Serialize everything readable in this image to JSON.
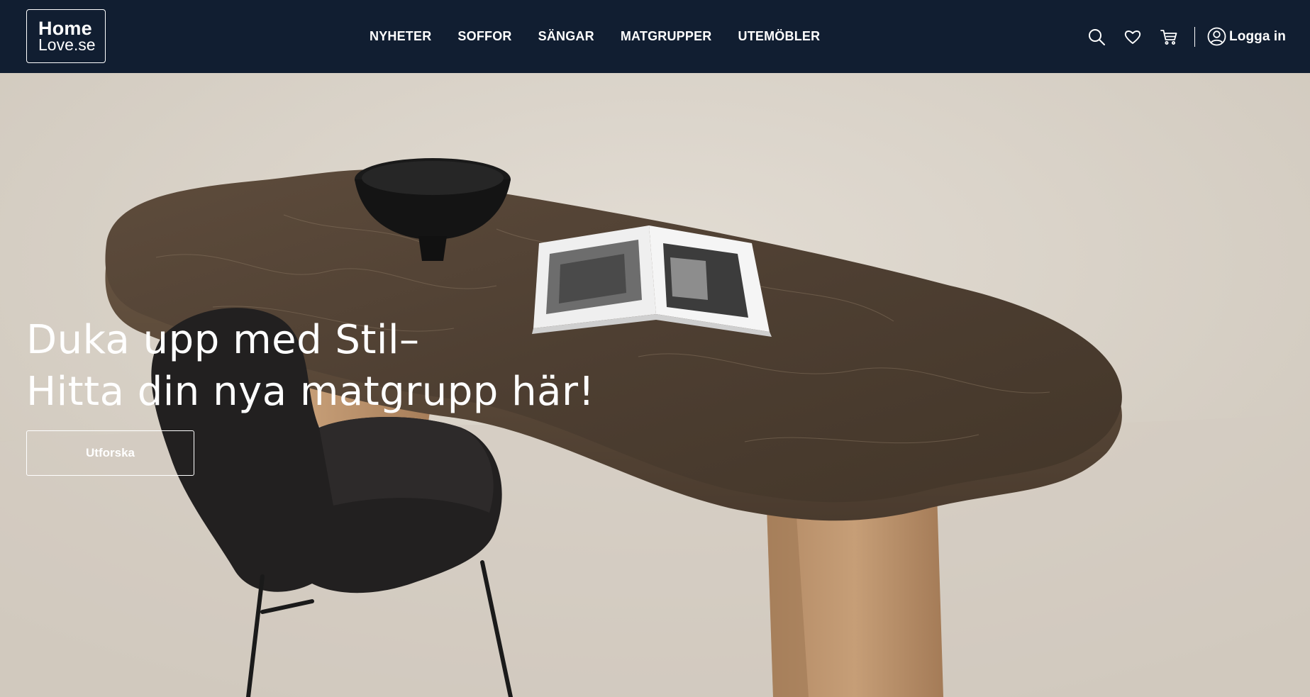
{
  "brand": {
    "line1": "Home",
    "line2": "Love.se"
  },
  "nav": {
    "items": [
      {
        "label": "NYHETER"
      },
      {
        "label": "SOFFOR"
      },
      {
        "label": "SÄNGAR"
      },
      {
        "label": "MATGRUPPER"
      },
      {
        "label": "UTEMÖBLER"
      }
    ]
  },
  "header_actions": {
    "icons": [
      "search-icon",
      "heart-icon",
      "cart-icon",
      "user-icon"
    ],
    "login_label": "Logga in"
  },
  "hero": {
    "title_line1": "Duka upp med Stil–",
    "title_line2": "Hitta din nya matgrupp här!",
    "cta_label": "Utforska"
  },
  "colors": {
    "header_bg": "#111e31",
    "text_on_dark": "#ffffff",
    "hero_bg": "#d8d2c8"
  }
}
